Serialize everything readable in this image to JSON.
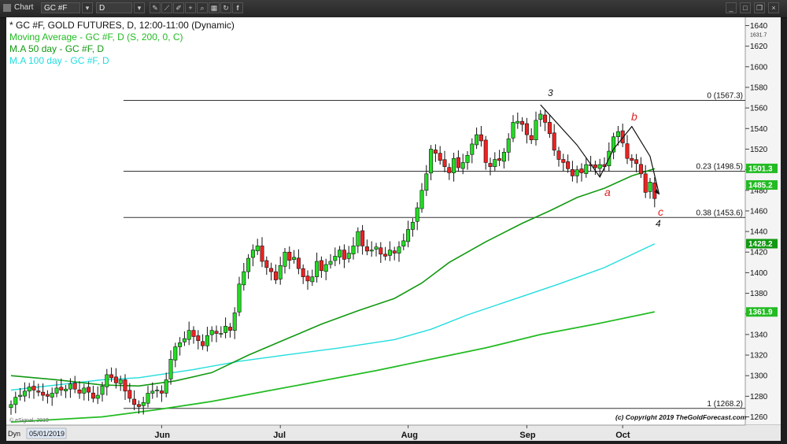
{
  "toolbar": {
    "app_label": "Chart",
    "symbol": "GC #F",
    "interval": "D",
    "tools": [
      "pencil-icon",
      "draw-icon",
      "pen-icon",
      "crosshair-icon",
      "zoom-icon",
      "calendar-icon",
      "refresh-icon",
      "facebook-icon"
    ]
  },
  "legend": [
    {
      "text": "* GC #F, GOLD FUTURES, D, 12:00-11:00 (Dynamic)",
      "color": "#111111"
    },
    {
      "text": "Moving Average - GC #F, D (S, 200, 0, C)",
      "color": "#22bb22"
    },
    {
      "text": "M.A 50 day - GC #F, D",
      "color": "#119911"
    },
    {
      "text": "M.A 100 day - GC #F, D",
      "color": "#22dddd"
    }
  ],
  "annotations": {
    "wave_3": "3",
    "wave_4": "4",
    "wave_a": "a",
    "wave_b": "b",
    "wave_c": "c",
    "copyright": "(c) Copyright 2019  TheGoldForecast.com",
    "esignal": "© eSignal, 2019",
    "dyn_label": "Dyn",
    "date_box": "05/01/2019"
  },
  "chart_data": {
    "type": "candlestick",
    "title": "* GC #F, GOLD FUTURES, D, 12:00-11:00 (Dynamic)",
    "ylim": [
      1252,
      1648
    ],
    "y_ticks": [
      1260,
      1280,
      1300,
      1320,
      1340,
      1360,
      1380,
      1400,
      1420,
      1440,
      1460,
      1480,
      1500,
      1520,
      1540,
      1560,
      1580,
      1600,
      1620,
      1640
    ],
    "top_label": "1631.7",
    "x_labels": [
      "Jun",
      "Jul",
      "Aug",
      "Sep",
      "Oct"
    ],
    "x_label_index": [
      33,
      59,
      87,
      113,
      134
    ],
    "fib_levels": [
      {
        "label": "0 (1567.3)",
        "value": 1567.3
      },
      {
        "label": "0.23 (1498.5)",
        "value": 1498.5
      },
      {
        "label": "0.38 (1453.6)",
        "value": 1453.6
      },
      {
        "label": "1 (1268.2)",
        "value": 1268.2
      }
    ],
    "price_tags": [
      {
        "label": "1501.3",
        "value": 1501.3,
        "bg": "#22bb22",
        "fg": "#ffffff"
      },
      {
        "label": "1485.2",
        "value": 1485.2,
        "bg": "#22bb22",
        "fg": "#ffffff"
      },
      {
        "label": "1428.2",
        "value": 1428.2,
        "bg": "#119911",
        "fg": "#ffffff"
      },
      {
        "label": "1361.9",
        "value": 1361.9,
        "bg": "#22bb22",
        "fg": "#ffffff"
      }
    ],
    "closes": [
      1272,
      1279,
      1281,
      1285,
      1289,
      1286,
      1284,
      1281,
      1280,
      1283,
      1288,
      1286,
      1287,
      1292,
      1287,
      1283,
      1288,
      1284,
      1278,
      1281,
      1290,
      1301,
      1298,
      1293,
      1296,
      1285,
      1278,
      1272,
      1270,
      1274,
      1283,
      1285,
      1286,
      1283,
      1296,
      1316,
      1328,
      1332,
      1336,
      1344,
      1338,
      1334,
      1329,
      1339,
      1344,
      1341,
      1341,
      1348,
      1344,
      1361,
      1389,
      1401,
      1414,
      1422,
      1426,
      1411,
      1405,
      1401,
      1393,
      1407,
      1420,
      1412,
      1415,
      1404,
      1396,
      1392,
      1396,
      1411,
      1402,
      1408,
      1411,
      1416,
      1422,
      1413,
      1419,
      1426,
      1440,
      1426,
      1421,
      1422,
      1425,
      1418,
      1416,
      1422,
      1419,
      1425,
      1431,
      1442,
      1449,
      1463,
      1480,
      1496,
      1520,
      1516,
      1509,
      1503,
      1497,
      1511,
      1502,
      1507,
      1514,
      1525,
      1534,
      1528,
      1507,
      1503,
      1510,
      1509,
      1517,
      1530,
      1546,
      1547,
      1544,
      1534,
      1529,
      1548,
      1554,
      1546,
      1535,
      1519,
      1510,
      1507,
      1501,
      1494,
      1500,
      1497,
      1505,
      1504,
      1502,
      1505,
      1503,
      1518,
      1532,
      1537,
      1526,
      1511,
      1509,
      1506,
      1496,
      1478,
      1488,
      1472
    ],
    "ma50_pts": [
      [
        0,
        1300
      ],
      [
        10,
        1296
      ],
      [
        20,
        1291
      ],
      [
        28,
        1290
      ],
      [
        36,
        1295
      ],
      [
        44,
        1303
      ],
      [
        52,
        1320
      ],
      [
        60,
        1335
      ],
      [
        68,
        1350
      ],
      [
        76,
        1363
      ],
      [
        84,
        1375
      ],
      [
        90,
        1390
      ],
      [
        96,
        1410
      ],
      [
        104,
        1430
      ],
      [
        112,
        1448
      ],
      [
        118,
        1460
      ],
      [
        124,
        1473
      ],
      [
        130,
        1482
      ],
      [
        136,
        1494
      ],
      [
        141,
        1501
      ]
    ],
    "ma100_pts": [
      [
        0,
        1286
      ],
      [
        12,
        1292
      ],
      [
        20,
        1296
      ],
      [
        28,
        1298
      ],
      [
        40,
        1306
      ],
      [
        50,
        1314
      ],
      [
        60,
        1320
      ],
      [
        72,
        1327
      ],
      [
        84,
        1335
      ],
      [
        92,
        1345
      ],
      [
        100,
        1359
      ],
      [
        110,
        1374
      ],
      [
        120,
        1389
      ],
      [
        130,
        1405
      ],
      [
        141,
        1428
      ]
    ],
    "ma200_pts": [
      [
        0,
        1255
      ],
      [
        20,
        1260
      ],
      [
        32,
        1267
      ],
      [
        44,
        1275
      ],
      [
        56,
        1285
      ],
      [
        68,
        1295
      ],
      [
        80,
        1305
      ],
      [
        92,
        1316
      ],
      [
        104,
        1327
      ],
      [
        116,
        1340
      ],
      [
        128,
        1350
      ],
      [
        141,
        1362
      ]
    ],
    "wave_lines": [
      [
        [
          116,
          1563
        ],
        [
          124,
          1524
        ],
        [
          129,
          1493
        ],
        [
          132,
          1520
        ],
        [
          136,
          1542
        ],
        [
          140,
          1513
        ],
        [
          142,
          1476
        ]
      ]
    ]
  }
}
